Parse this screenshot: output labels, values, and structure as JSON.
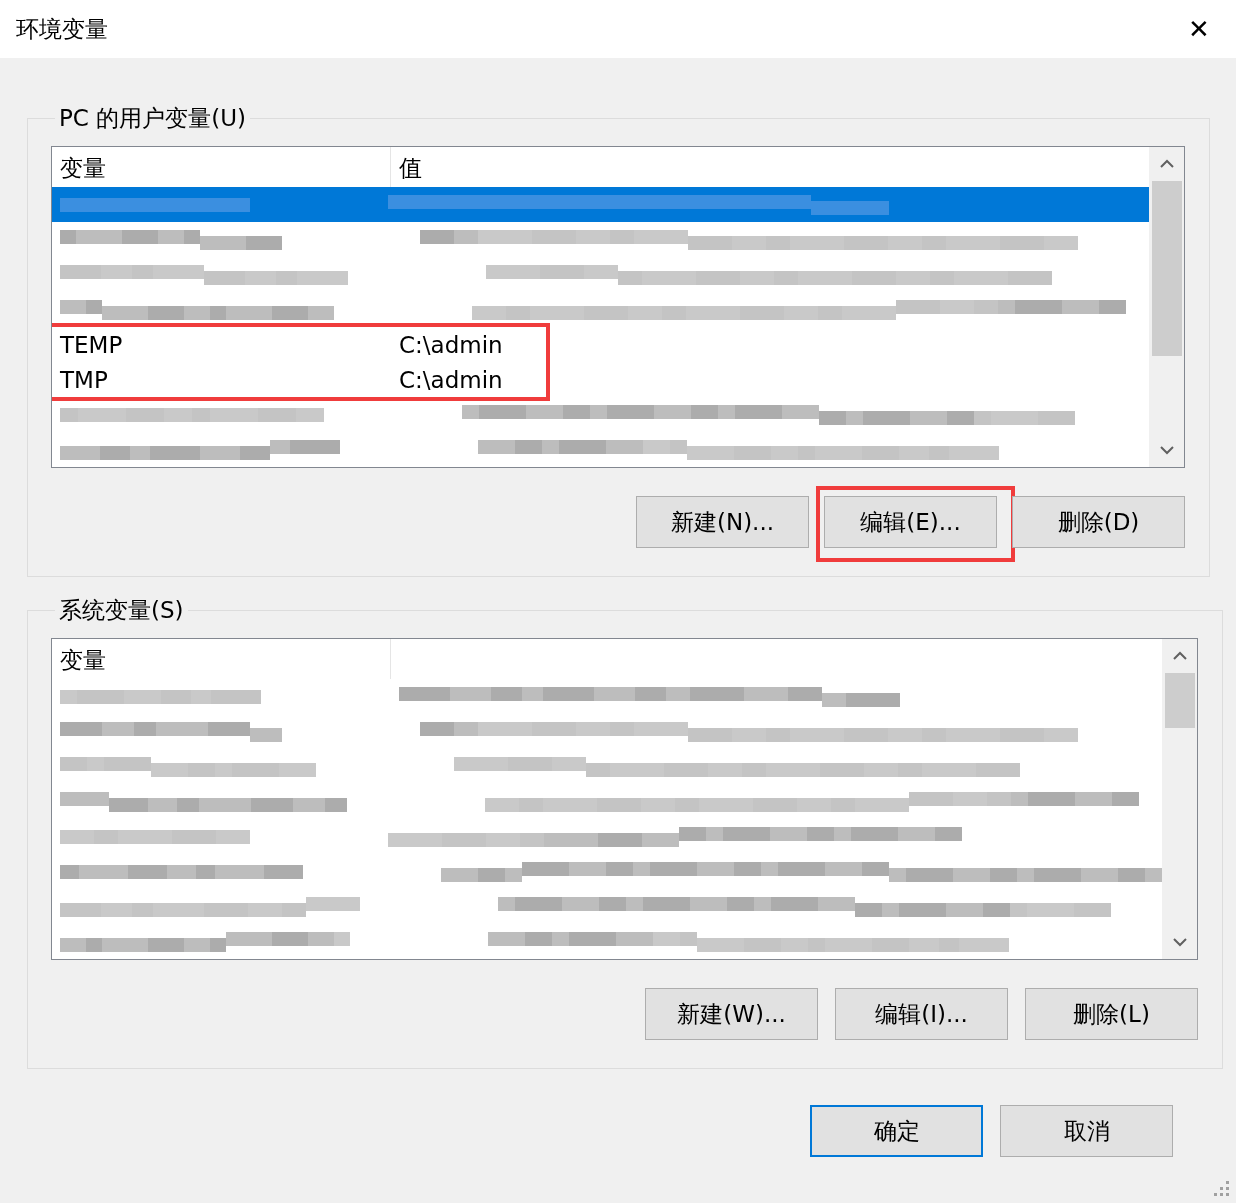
{
  "window": {
    "title": "环境变量",
    "close": "✕"
  },
  "user_variables": {
    "title": "PC 的用户变量(U)",
    "columns": [
      "变量",
      "值"
    ],
    "rows": [
      {
        "kind": "redacted",
        "selected": true,
        "highlighted": false
      },
      {
        "kind": "redacted",
        "selected": false,
        "highlighted": false
      },
      {
        "kind": "redacted",
        "selected": false,
        "highlighted": false
      },
      {
        "kind": "redacted",
        "selected": false,
        "highlighted": false
      },
      {
        "kind": "text",
        "name": "TEMP",
        "value": "C:\\admin",
        "selected": false,
        "highlighted": true
      },
      {
        "kind": "text",
        "name": "TMP",
        "value": "C:\\admin",
        "selected": false,
        "highlighted": true
      },
      {
        "kind": "redacted",
        "selected": false,
        "highlighted": false
      },
      {
        "kind": "redacted",
        "selected": false,
        "highlighted": false
      }
    ],
    "buttons": [
      {
        "label": "新建(N)...",
        "highlighted": false
      },
      {
        "label": "编辑(E)...",
        "highlighted": true
      },
      {
        "label": "删除(D)",
        "highlighted": false
      }
    ]
  },
  "system_variables": {
    "title": "系统变量(S)",
    "columns": [
      "变量"
    ],
    "rows": [
      {
        "kind": "redacted",
        "selected": false,
        "highlighted": false
      },
      {
        "kind": "redacted",
        "selected": false,
        "highlighted": false
      },
      {
        "kind": "redacted",
        "selected": false,
        "highlighted": false
      },
      {
        "kind": "redacted",
        "selected": false,
        "highlighted": false
      },
      {
        "kind": "redacted",
        "selected": false,
        "highlighted": false
      },
      {
        "kind": "redacted",
        "selected": false,
        "highlighted": false
      },
      {
        "kind": "redacted",
        "selected": false,
        "highlighted": false
      },
      {
        "kind": "redacted",
        "selected": false,
        "highlighted": false
      }
    ],
    "buttons": [
      {
        "label": "新建(W)...",
        "highlighted": false
      },
      {
        "label": "编辑(I)...",
        "highlighted": false
      },
      {
        "label": "删除(L)",
        "highlighted": false
      }
    ]
  },
  "footer_buttons": [
    {
      "label": "确定",
      "default": true
    },
    {
      "label": "取消",
      "default": false
    }
  ]
}
